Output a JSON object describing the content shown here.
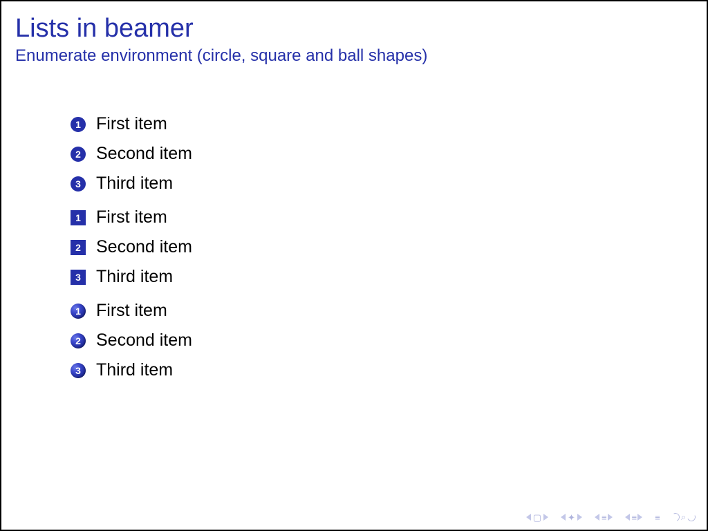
{
  "title": "Lists in beamer",
  "subtitle": "Enumerate environment (circle, square and ball shapes)",
  "lists": {
    "circle": [
      {
        "n": "1",
        "label": "First item"
      },
      {
        "n": "2",
        "label": "Second item"
      },
      {
        "n": "3",
        "label": "Third item"
      }
    ],
    "square": [
      {
        "n": "1",
        "label": "First item"
      },
      {
        "n": "2",
        "label": "Second item"
      },
      {
        "n": "3",
        "label": "Third item"
      }
    ],
    "ball": [
      {
        "n": "1",
        "label": "First item"
      },
      {
        "n": "2",
        "label": "Second item"
      },
      {
        "n": "3",
        "label": "Third item"
      }
    ]
  },
  "colors": {
    "structure": "#2530a9",
    "nav_faded": "#b9bde0"
  }
}
